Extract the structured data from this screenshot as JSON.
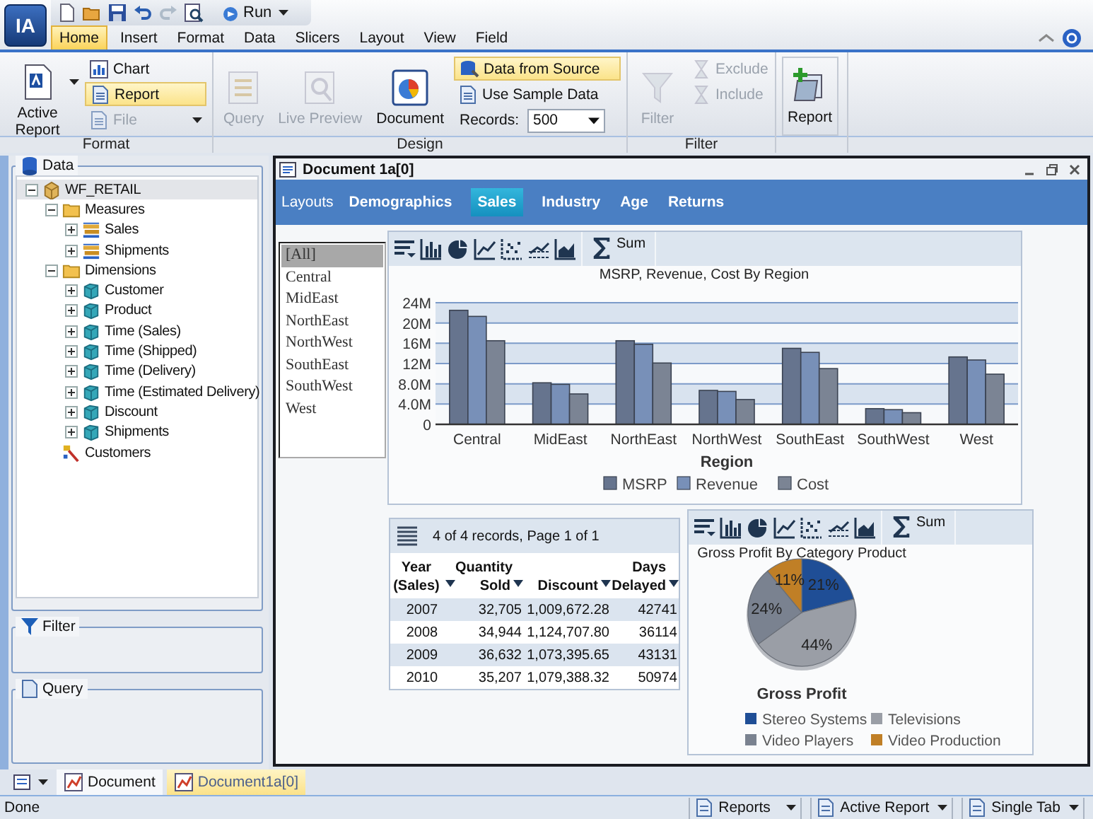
{
  "app": {
    "logo": "IA",
    "run_button": "Run"
  },
  "menu_tabs": [
    {
      "label": "Home",
      "selected": true
    },
    {
      "label": "Insert",
      "selected": false
    },
    {
      "label": "Format",
      "selected": false
    },
    {
      "label": "Data",
      "selected": false
    },
    {
      "label": "Slicers",
      "selected": false
    },
    {
      "label": "Layout",
      "selected": false
    },
    {
      "label": "View",
      "selected": false
    },
    {
      "label": "Field",
      "selected": false
    }
  ],
  "ribbon": {
    "groups": [
      {
        "label": "Format",
        "large": [
          {
            "label": "Active Report",
            "disabled": false,
            "dropdown": true
          }
        ],
        "small": [
          {
            "label": "Chart",
            "disabled": false,
            "selected": false,
            "dropdown": false
          },
          {
            "label": "Report",
            "disabled": false,
            "selected": true,
            "dropdown": false
          },
          {
            "label": "File",
            "disabled": true,
            "selected": false,
            "dropdown": true
          }
        ]
      },
      {
        "label": "Design",
        "large": [
          {
            "label": "Query",
            "disabled": true,
            "dropdown": false
          },
          {
            "label": "Live Preview",
            "disabled": true,
            "dropdown": false
          },
          {
            "label": "Document",
            "disabled": false,
            "dropdown": false
          }
        ],
        "small": [
          {
            "label": "Data from Source",
            "disabled": false,
            "selected": true,
            "dropdown": false
          },
          {
            "label": "Use Sample Data",
            "disabled": false,
            "selected": false,
            "dropdown": false
          }
        ],
        "records": {
          "label": "Records:",
          "value": "500"
        }
      },
      {
        "label": "Filter",
        "large": [
          {
            "label": "Filter",
            "disabled": true,
            "dropdown": false
          }
        ],
        "small": [
          {
            "label": "Exclude",
            "disabled": true,
            "selected": false,
            "dropdown": false
          },
          {
            "label": "Include",
            "disabled": true,
            "selected": false,
            "dropdown": false
          }
        ]
      },
      {
        "large": [
          {
            "label": "Report",
            "disabled": false,
            "dropdown": false
          }
        ]
      }
    ]
  },
  "left_panel": {
    "data": {
      "title": "Data",
      "tree": [
        {
          "label": "WF_RETAIL",
          "kind": "cube",
          "expanded": true,
          "selected": true,
          "children": [
            {
              "label": "Measures",
              "kind": "folder",
              "expanded": true,
              "selected": false,
              "children": [
                {
                  "label": "Sales",
                  "kind": "measure",
                  "expanded": false,
                  "selected": false
                },
                {
                  "label": "Shipments",
                  "kind": "measure",
                  "expanded": false,
                  "selected": false
                }
              ]
            },
            {
              "label": "Dimensions",
              "kind": "folder",
              "expanded": true,
              "selected": false,
              "children": [
                {
                  "label": "Customer",
                  "kind": "dimension",
                  "expanded": false,
                  "selected": false
                },
                {
                  "label": "Product",
                  "kind": "dimension",
                  "expanded": false,
                  "selected": false
                },
                {
                  "label": "Time (Sales)",
                  "kind": "dimension",
                  "expanded": false,
                  "selected": false
                },
                {
                  "label": "Time (Shipped)",
                  "kind": "dimension",
                  "expanded": false,
                  "selected": false
                },
                {
                  "label": "Time (Delivery)",
                  "kind": "dimension",
                  "expanded": false,
                  "selected": false
                },
                {
                  "label": "Time (Estimated Delivery)",
                  "kind": "dimension",
                  "expanded": false,
                  "selected": false
                },
                {
                  "label": "Discount",
                  "kind": "dimension",
                  "expanded": false,
                  "selected": false
                },
                {
                  "label": "Shipments",
                  "kind": "dimension",
                  "expanded": false,
                  "selected": false
                }
              ]
            },
            {
              "label": "Customers",
              "kind": "hierarchy",
              "selected": false
            }
          ]
        }
      ]
    },
    "filter": {
      "title": "Filter"
    },
    "query": {
      "title": "Query"
    }
  },
  "document": {
    "title": "Document 1a[0]",
    "layouts_label": "Layouts",
    "tabs": [
      {
        "label": "Demographics",
        "selected": false
      },
      {
        "label": "Sales",
        "selected": true
      },
      {
        "label": "Industry",
        "selected": false
      },
      {
        "label": "Age",
        "selected": false
      },
      {
        "label": "Returns",
        "selected": false
      }
    ],
    "slicer": [
      {
        "label": "[All]",
        "selected": true
      },
      {
        "label": "Central",
        "selected": false
      },
      {
        "label": "MidEast",
        "selected": false
      },
      {
        "label": "NorthEast",
        "selected": false
      },
      {
        "label": "NorthWest",
        "selected": false
      },
      {
        "label": "SouthEast",
        "selected": false
      },
      {
        "label": "SouthWest",
        "selected": false
      },
      {
        "label": "West",
        "selected": false
      }
    ],
    "bar_chart": {
      "sum_label": "Sum",
      "chart_data": {
        "type": "bar",
        "title": "MSRP, Revenue, Cost By Region",
        "xlabel": "Region",
        "categories": [
          "Central",
          "MidEast",
          "NorthEast",
          "NorthWest",
          "SouthEast",
          "SouthWest",
          "West"
        ],
        "series": [
          {
            "name": "MSRP",
            "color": "#66748e",
            "values": [
              22.5,
              8.2,
              16.5,
              6.7,
              15.0,
              3.1,
              13.3
            ]
          },
          {
            "name": "Revenue",
            "color": "#7890b8",
            "values": [
              21.3,
              7.9,
              15.8,
              6.5,
              14.2,
              2.9,
              12.7
            ]
          },
          {
            "name": "Cost",
            "color": "#7b8494",
            "values": [
              16.5,
              6.0,
              12.1,
              4.9,
              11.0,
              2.3,
              9.9
            ]
          }
        ],
        "ylim": [
          0,
          24
        ],
        "yticks": [
          {
            "value": 0,
            "label": "0"
          },
          {
            "value": 4,
            "label": "4.0M"
          },
          {
            "value": 8,
            "label": "8.0M"
          },
          {
            "value": 12,
            "label": "12M"
          },
          {
            "value": 16,
            "label": "16M"
          },
          {
            "value": 20,
            "label": "20M"
          },
          {
            "value": 24,
            "label": "24M"
          }
        ],
        "grid": true,
        "legend": "bottom"
      }
    },
    "table": {
      "caption": "4 of 4 records, Page 1 of 1",
      "columns": [
        "Year (Sales)",
        "Quantity Sold",
        "Discount",
        "Days Delayed"
      ],
      "rows": [
        [
          "2007",
          "32,705",
          "1,009,672.28",
          "42741"
        ],
        [
          "2008",
          "34,944",
          "1,124,707.80",
          "36114"
        ],
        [
          "2009",
          "36,632",
          "1,073,395.65",
          "43131"
        ],
        [
          "2010",
          "35,207",
          "1,079,388.32",
          "50974"
        ]
      ]
    },
    "pie_chart": {
      "sum_label": "Sum",
      "slices": [
        {
          "color": "#1f4e96"
        },
        {
          "color": "#9a9ea6"
        },
        {
          "color": "#7a8290"
        },
        {
          "color": "#c07f26"
        }
      ],
      "chart_data": {
        "type": "pie",
        "title": "Gross Profit By Category Product",
        "categories": [
          "Stereo Systems",
          "Televisions",
          "Video Players",
          "Video Production"
        ],
        "series": [
          {
            "name": "Gross Profit",
            "values": [
              21,
              44,
              24,
              11
            ]
          }
        ],
        "value_labels": [
          "21%",
          "44%",
          "24%",
          "11%"
        ],
        "legend": "bottom"
      }
    }
  },
  "bottom_tabs": [
    {
      "label": "Document",
      "selected": false
    },
    {
      "label": "Document1a[0]",
      "selected": true
    }
  ],
  "status_bar": {
    "text": "Done",
    "dropdowns": [
      "Reports",
      "Active Report",
      "Single Tab"
    ]
  }
}
